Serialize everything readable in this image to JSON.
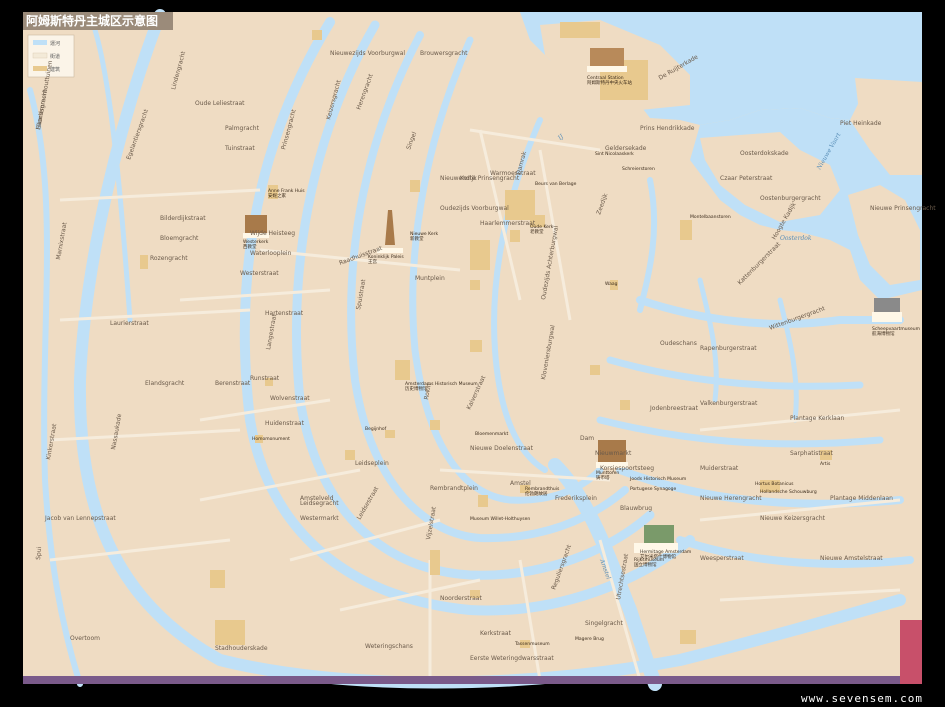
{
  "title": "阿姆斯特丹主城区示意图",
  "legend": {
    "items": [
      {
        "label": "運河",
        "color": "#bfe0f7"
      },
      {
        "label": "街道",
        "color": "#f3ead8"
      },
      {
        "label": "建筑",
        "color": "#e8c98e"
      }
    ]
  },
  "colors": {
    "land": "#efdcc3",
    "water": "#bfe0f7",
    "building": "#e8c98e",
    "street": "#f6ecdc",
    "frame": "#000000"
  },
  "watermark": "www.sevensem.com",
  "streets": [
    "Haarlemmerhouttuinen",
    "Brouwersgracht",
    "Prinsengracht",
    "Keizersgracht",
    "Herengracht",
    "Singel",
    "Lindengracht",
    "Westerstraat",
    "Bloemgracht",
    "Rozengracht",
    "Elandsgracht",
    "Leidsegracht",
    "Leidsestraat",
    "Vijzelstraat",
    "Utrechtsestraat",
    "Reguliersgracht",
    "Amstel",
    "Rokin",
    "Damrak",
    "Nieuwendijk",
    "Kalverstraat",
    "Spuistraat",
    "Raadhuisstraat",
    "Warmoesstraat",
    "Zeedijk",
    "Geldersekade",
    "Kloveniersburgwal",
    "Oudezijds Achterburgwal",
    "Nieuwe Herengracht",
    "Nieuwe Keizersgracht",
    "Plantage Middenlaan",
    "Weesperstraat",
    "Sarphatistraat",
    "Muiderstraat",
    "Prins Hendrikkade",
    "De Ruijterkade",
    "Oosterdokskade",
    "Marnixstraat",
    "Nassaukade",
    "Kinkerstraat",
    "Jacob van Lennepstraat",
    "Bilderdijkstraat",
    "Overtoom",
    "Stadhouderskade",
    "Weteringschans",
    "Noorderstraat",
    "Kerkstraat",
    "Piet Heinkade",
    "Kattenburgerstraat",
    "Wittenburgergracht",
    "Rapenburgerstraat",
    "Oudeschans",
    "Valkenburgerstraat",
    "Jodenbreestraat",
    "Nieuwe Doelenstraat",
    "Oude Leliestraat",
    "Langestraat",
    "Hartenstraat",
    "Wolvenstraat",
    "Runstraat",
    "Huidenstraat",
    "Berenstraat",
    "Laurierstraat",
    "Egelantiersgracht",
    "Palmgracht",
    "Tuinstraat",
    "Eerste Weteringdwarsstraat",
    "Frederiksplein",
    "Rembrandtplein",
    "Muntplein",
    "Dam",
    "Nieuwmarkt",
    "Waterlooplein",
    "Westermarkt",
    "Leidseplein",
    "Spui",
    "Singelgracht",
    "Amstelveld",
    "Wijde Heisteeg",
    "Korte Prinsengracht",
    "Oudezijds Voorburgwal",
    "Nieuwezijds Voorburgwal",
    "Haarlemmerstraat",
    "Korsjespoortsteeg",
    "Blauwbrug",
    "Nieuwe Amstelstraat",
    "Plantage Kerklaan",
    "Nieuwe Prinsengracht",
    "Hoogte Kadijk",
    "Oostenburgergracht",
    "Czaar Peterstraat",
    "Eilandsgracht"
  ],
  "landmarks": [
    {
      "name": "Centraal Station",
      "cn": "阿姆斯特丹中央火车站"
    },
    {
      "name": "Westerkerk",
      "cn": "西教堂"
    },
    {
      "name": "Koninklijk Paleis",
      "cn": "王宫"
    },
    {
      "name": "Munttoren",
      "cn": "铸币塔"
    },
    {
      "name": "Rijksmuseum",
      "cn": "国立博物馆"
    },
    {
      "name": "Hermitage Amsterdam",
      "cn": "艾尔米塔什博物馆"
    },
    {
      "name": "Scheepvaartmuseum",
      "cn": "航海博物馆"
    },
    {
      "name": "Anne Frank Huis",
      "cn": "安妮之家"
    },
    {
      "name": "Oude Kerk",
      "cn": "老教堂"
    },
    {
      "name": "Nieuwe Kerk",
      "cn": "新教堂"
    },
    {
      "name": "Amsterdams Historisch Museum",
      "cn": "历史博物馆"
    },
    {
      "name": "Museum Willet-Holthuysen",
      "cn": ""
    },
    {
      "name": "Rembrandthuis",
      "cn": "伦勃朗故居"
    },
    {
      "name": "Joods Historisch Museum",
      "cn": ""
    },
    {
      "name": "Portugese Synagoge",
      "cn": ""
    },
    {
      "name": "Hortus Botanicus",
      "cn": ""
    },
    {
      "name": "Hollandsche Schouwburg",
      "cn": ""
    },
    {
      "name": "Artis",
      "cn": ""
    },
    {
      "name": "Tassenmuseum",
      "cn": ""
    },
    {
      "name": "Homomonument",
      "cn": ""
    },
    {
      "name": "Begijnhof",
      "cn": ""
    },
    {
      "name": "Beurs van Berlage",
      "cn": ""
    },
    {
      "name": "Sint Nicolaaskerk",
      "cn": ""
    },
    {
      "name": "Waag",
      "cn": ""
    },
    {
      "name": "Montelbaanstoren",
      "cn": ""
    },
    {
      "name": "Schreierstoren",
      "cn": ""
    },
    {
      "name": "Bloemenmarkt",
      "cn": ""
    },
    {
      "name": "Magere Brug",
      "cn": ""
    }
  ],
  "water_labels": [
    "IJ",
    "Oosterdok",
    "Amstel",
    "Nieuwe Vaart"
  ]
}
